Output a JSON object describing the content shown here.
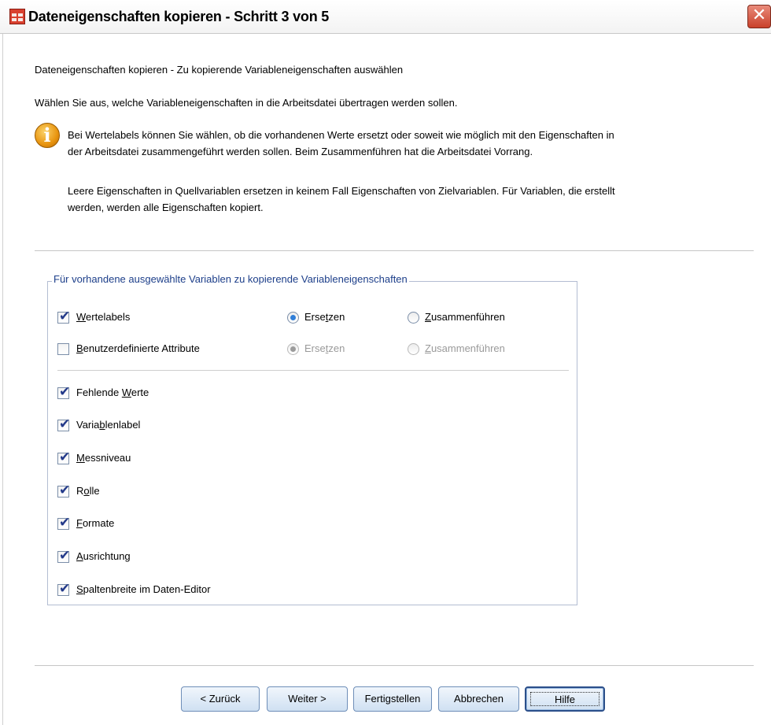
{
  "window": {
    "title": "Dateneigenschaften kopieren - Schritt 3 von 5",
    "close_symbol": "✕",
    "icon": "spreadsheet-app-icon"
  },
  "content": {
    "header": "Dateneigenschaften kopieren - Zu kopierende Variableneigenschaften auswählen",
    "instruction": "Wählen Sie aus, welche Variableneigenschaften in die Arbeitsdatei übertragen werden sollen.",
    "info_icon_symbol": "i",
    "info_paragraph_1_line_1": "Bei Wertelabels können Sie wählen, ob die vorhandenen Werte ersetzt oder soweit wie möglich mit den Eigenschaften in",
    "info_paragraph_1_line_2": "der Arbeitsdatei zusammengeführt werden sollen. Beim Zusammenführen hat die Arbeitsdatei Vorrang.",
    "info_paragraph_2_line_1": "Leere Eigenschaften in Quellvariablen ersetzen in keinem Fall Eigenschaften von Zielvariablen. Für Variablen, die erstellt",
    "info_paragraph_2_line_2": "werden, werden alle Eigenschaften kopiert."
  },
  "group": {
    "title": "Für vorhandene ausgewählte Variablen zu kopierende Variableneigenschaften",
    "wertelabels": {
      "label_prefix": "",
      "label_underlined": "W",
      "label_rest": "ertelabels",
      "checked": true,
      "mode": "Ersetzen",
      "radio_replace": {
        "pre": "Erse",
        "u": "t",
        "post": "zen"
      },
      "radio_merge": {
        "pre": "",
        "u": "Z",
        "post": "usammenführen"
      },
      "enabled": true
    },
    "attribute": {
      "label_prefix": "",
      "label_underlined": "B",
      "label_rest": "enutzerdefinierte Attribute",
      "checked": false,
      "mode": "Ersetzen",
      "radio_replace": {
        "pre": "Erse",
        "u": "t",
        "post": "zen"
      },
      "radio_merge": {
        "pre": "",
        "u": "Z",
        "post": "usammenführen"
      },
      "enabled": false
    },
    "items": [
      {
        "pre": "Fehlende ",
        "u": "W",
        "post": "erte",
        "checked": true
      },
      {
        "pre": "Varia",
        "u": "b",
        "post": "lenlabel",
        "checked": true
      },
      {
        "pre": "",
        "u": "M",
        "post": "essniveau",
        "checked": true
      },
      {
        "pre": "R",
        "u": "o",
        "post": "lle",
        "checked": true
      },
      {
        "pre": "",
        "u": "F",
        "post": "ormate",
        "checked": true
      },
      {
        "pre": "",
        "u": "A",
        "post": "usrichtung",
        "checked": true
      },
      {
        "pre": "",
        "u": "S",
        "post": "paltenbreite im Daten-Editor",
        "checked": true
      }
    ]
  },
  "buttons": {
    "back": "< Zurück",
    "next": "Weiter >",
    "finish": "Fertigstellen",
    "cancel": "Abbrechen",
    "help": "Hilfe"
  },
  "colors": {
    "group_title": "#1d3f8a",
    "check_tick": "#233a8a",
    "radio_dot": "#2f7ed8",
    "close_button": "#c9412b"
  }
}
